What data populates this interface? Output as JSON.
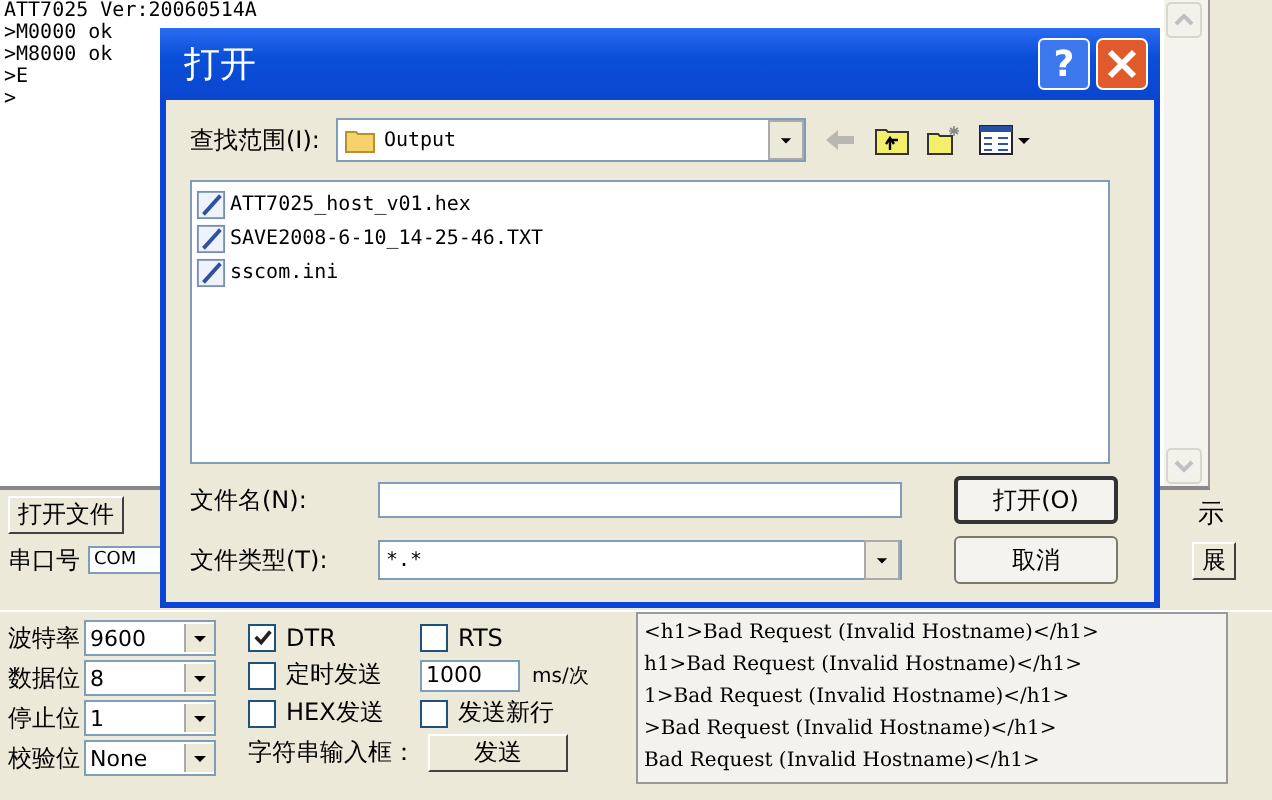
{
  "terminal": {
    "lines": [
      "ATT7025 Ver:20060514A",
      ">M0000 ok",
      ">M8000 ok",
      ">E",
      ">"
    ]
  },
  "open_file_button": "打开文件",
  "side_label": "示",
  "side_button": "展",
  "port": {
    "label": "串口号",
    "value": "COM"
  },
  "settings": [
    {
      "label": "波特率",
      "value": "9600"
    },
    {
      "label": "数据位",
      "value": "8"
    },
    {
      "label": "停止位",
      "value": "1"
    },
    {
      "label": "校验位",
      "value": "None"
    }
  ],
  "options": [
    {
      "kind": "checkbox",
      "label": "DTR",
      "checked": true
    },
    {
      "kind": "checkbox",
      "label": "RTS",
      "checked": false
    },
    {
      "kind": "checkbox",
      "label": "定时发送",
      "checked": false
    },
    {
      "kind": "interval",
      "value": "1000",
      "unit": "ms/次"
    },
    {
      "kind": "checkbox",
      "label": "HEX发送",
      "checked": false
    },
    {
      "kind": "checkbox",
      "label": "发送新行",
      "checked": false
    }
  ],
  "input_label": "字符串输入框：",
  "send_button": "发送",
  "received": {
    "lines": [
      "<h1>Bad Request (Invalid Hostname)</h1>",
      "h1>Bad Request (Invalid Hostname)</h1>",
      "1>Bad Request (Invalid Hostname)</h1>",
      ">Bad Request (Invalid Hostname)</h1>",
      "Bad Request (Invalid Hostname)</h1>"
    ]
  },
  "dialog": {
    "title": "打开",
    "help": "?",
    "look_in": {
      "label": "查找范围(I):",
      "value": "Output"
    },
    "files": [
      {
        "name": "ATT7025_host_v01.hex"
      },
      {
        "name": "SAVE2008-6-10_14-25-46.TXT"
      },
      {
        "name": "sscom.ini"
      }
    ],
    "file_name": {
      "label": "文件名(N):"
    },
    "file_type": {
      "label": "文件类型(T):",
      "value": "*.*"
    },
    "buttons": [
      "打开(O)",
      "取消"
    ]
  }
}
